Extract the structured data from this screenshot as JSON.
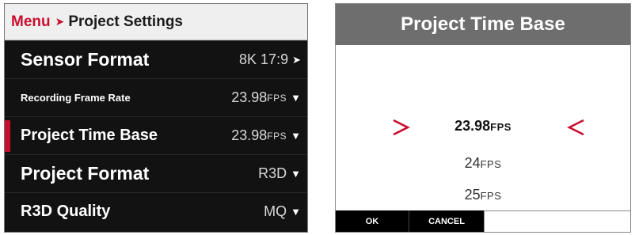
{
  "breadcrumb": {
    "menu": "Menu",
    "separator": "➤",
    "current": "Project Settings"
  },
  "menu_items": [
    {
      "label": "Sensor Format",
      "value": "8K 17:9",
      "unit": "",
      "arrow": "➤"
    },
    {
      "label": "Recording Frame Rate",
      "value": "23.98",
      "unit": "FPS",
      "arrow": "▼"
    },
    {
      "label": "Project Time Base",
      "value": "23.98",
      "unit": "FPS",
      "arrow": "▼",
      "selected": true
    },
    {
      "label": "Project Format",
      "value": "R3D",
      "unit": "",
      "arrow": "▼"
    },
    {
      "label": "R3D Quality",
      "value": "MQ",
      "unit": "",
      "arrow": "▼"
    }
  ],
  "dialog": {
    "title": "Project Time Base",
    "options": [
      {
        "value": "23.98",
        "unit": "FPS",
        "selected": true
      },
      {
        "value": "24",
        "unit": "FPS"
      },
      {
        "value": "25",
        "unit": "FPS"
      }
    ],
    "softkeys": {
      "ok": "OK",
      "cancel": "CANCEL"
    }
  },
  "colors": {
    "accent": "#c8102e",
    "header_gray": "#6e6e6e",
    "panel_bg": "#121212"
  },
  "icons": {
    "breadcrumb_separator": "chevron-right-icon",
    "picker_left": "chevron-right-outline-icon",
    "picker_right": "chevron-left-outline-icon"
  }
}
